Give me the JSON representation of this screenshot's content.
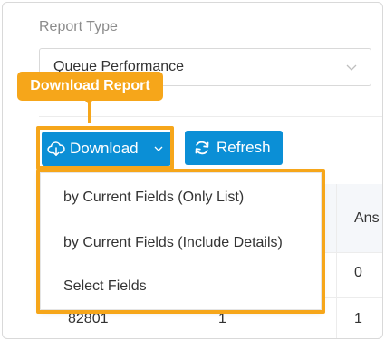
{
  "report_type": {
    "label": "Report Type",
    "selected": "Queue Performance"
  },
  "callout": {
    "text": "Download Report",
    "color": "#f6a61a"
  },
  "toolbar": {
    "download_label": "Download",
    "refresh_label": "Refresh",
    "button_color": "#0b8fd6"
  },
  "download_menu": {
    "items": [
      "by Current Fields (Only List)",
      "by Current Fields (Include Details)",
      "Select Fields"
    ]
  },
  "table": {
    "header_partial": "Ans",
    "rows": [
      {
        "c1": "",
        "c2": "",
        "c3": "0"
      },
      {
        "c1": "82801",
        "c2": "1",
        "c3": "1"
      }
    ]
  }
}
